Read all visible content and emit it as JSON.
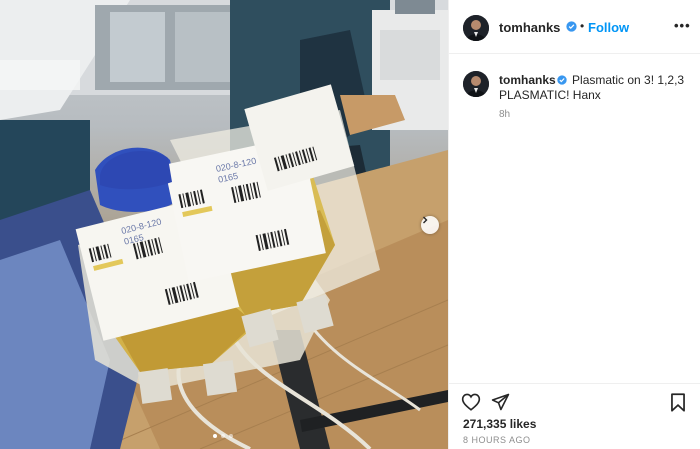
{
  "post": {
    "username": "tomhanks",
    "separator": "•",
    "follow_label": "Follow",
    "more_label": "•••",
    "caption": "Plasmatic on 3! 1,2,3 PLASMATIC! Hanx",
    "caption_time": "8h",
    "likes": "271,335 likes",
    "timestamp": "8 HOURS AGO",
    "verified": true,
    "carousel": {
      "total": 3,
      "active_index": 0
    }
  },
  "photo": {
    "left_bag_label_top": "020-8-120",
    "left_bag_label_sub": "0165",
    "right_bag_label_top": "020-8-120",
    "right_bag_label_sub": "0165"
  },
  "colors": {
    "accent": "#0095f6",
    "text": "#262626",
    "secondary_text": "#8e8e8e",
    "divider": "#efefef",
    "plasma": "#d8b54a",
    "glove": "#2f4fb3"
  },
  "icons": {
    "verified": "verified-badge-icon",
    "like": "heart-outline-icon",
    "share": "paper-plane-icon",
    "save": "bookmark-icon",
    "next": "chevron-right-icon",
    "more": "ellipsis-icon"
  }
}
